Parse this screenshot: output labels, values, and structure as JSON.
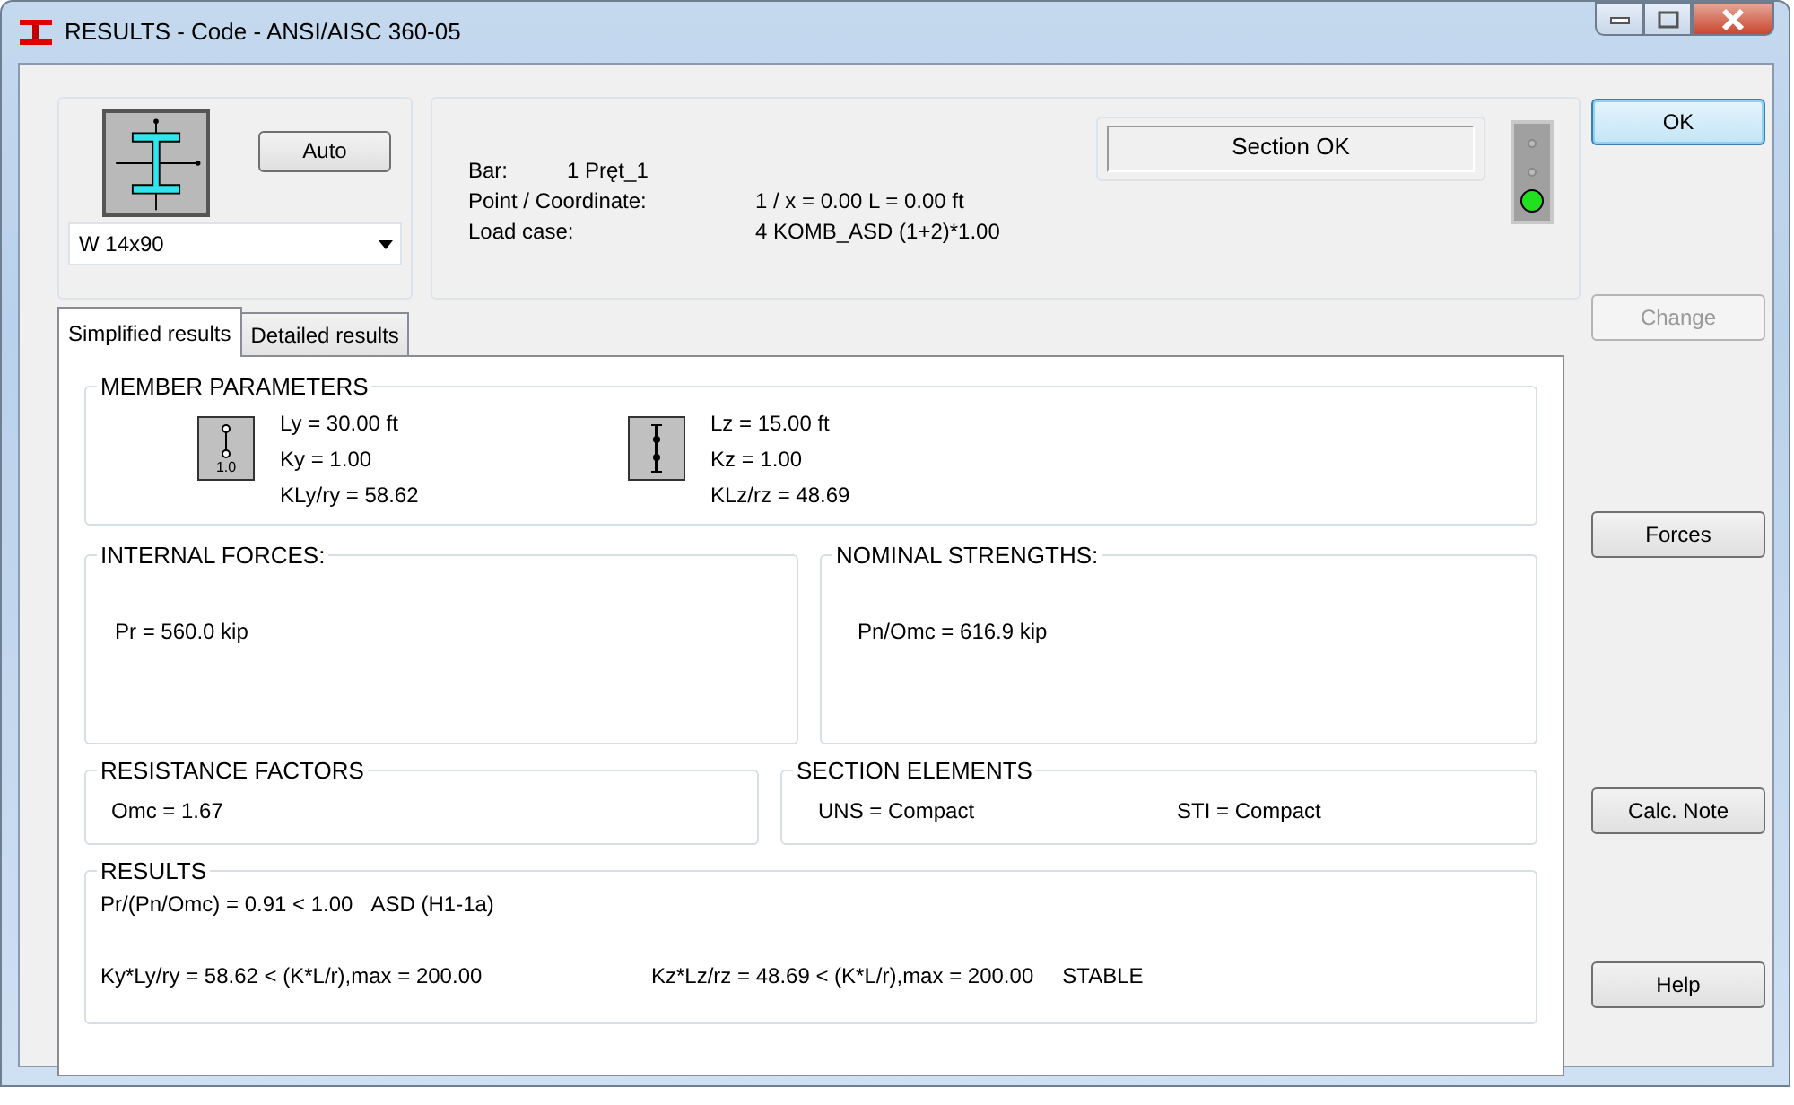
{
  "window": {
    "title": "RESULTS - Code - ANSI/AISC 360-05"
  },
  "section": {
    "button": "Auto",
    "profile": "W 14x90"
  },
  "info": [
    {
      "label": "Bar:",
      "value": "1  Pręt_1"
    },
    {
      "label": "Point / Coordinate:",
      "value": "1 / x = 0.00 L = 0.00 ft"
    },
    {
      "label": "Load case:",
      "value": "4 KOMB_ASD  (1+2)*1.00"
    }
  ],
  "status": {
    "text": "Section OK",
    "lamps": [
      {
        "on": false
      },
      {
        "on": false
      },
      {
        "on": true
      }
    ]
  },
  "tabs": [
    {
      "label": "Simplified results",
      "selected": true
    },
    {
      "label": "Detailed results",
      "selected": false
    }
  ],
  "member_parameters": {
    "title": "MEMBER PARAMETERS",
    "axes": [
      {
        "kind": "pinned",
        "icon_label": "1.0",
        "lines": [
          "Ly = 30.00 ft",
          "Ky = 1.00",
          "KLy/ry = 58.62"
        ]
      },
      {
        "kind": "braced",
        "lines": [
          "Lz = 15.00 ft",
          "Kz = 1.00",
          "KLz/rz = 48.69"
        ]
      }
    ]
  },
  "internal_forces": {
    "title": "INTERNAL FORCES:",
    "lines": [
      "Pr = 560.0 kip"
    ]
  },
  "nominal_strengths": {
    "title": "NOMINAL STRENGTHS:",
    "lines": [
      "Pn/Omc = 616.9 kip"
    ]
  },
  "resistance_factors": {
    "title": "RESISTANCE FACTORS",
    "lines": [
      "Omc = 1.67"
    ]
  },
  "section_elements": {
    "title": "SECTION ELEMENTS",
    "items": [
      "UNS = Compact",
      "STI = Compact"
    ]
  },
  "results": {
    "title": "RESULTS",
    "utilization": "Pr/(Pn/Omc) = 0.91 < 1.00",
    "utilization_note": "ASD (H1-1a)",
    "slenderness": [
      "Ky*Ly/ry = 58.62 < (K*L/r),max = 200.00",
      "Kz*Lz/rz = 48.69 < (K*L/r),max = 200.00"
    ],
    "verdict": "STABLE"
  },
  "buttons": [
    {
      "label": "OK",
      "disabled": false,
      "default": true
    },
    {
      "label": "Change",
      "disabled": true,
      "default": false
    },
    {
      "label": "Forces",
      "disabled": false,
      "default": false
    },
    {
      "label": "Calc. Note",
      "disabled": false,
      "default": false
    },
    {
      "label": "Help",
      "disabled": false,
      "default": false
    }
  ]
}
